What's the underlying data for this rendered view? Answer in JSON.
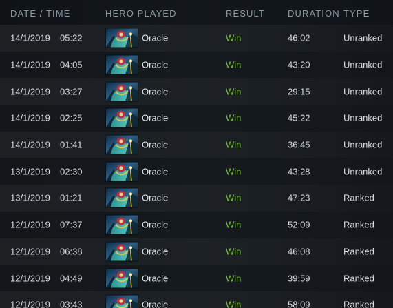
{
  "header": {
    "date_time": "DATE / TIME",
    "hero_played": "HERO PLAYED",
    "result": "RESULT",
    "duration": "DURATION",
    "type": "TYPE"
  },
  "colors": {
    "win": "#7cc13d",
    "text": "#d7dde2",
    "header": "#8e9aa3",
    "background": "#101417"
  },
  "rows": [
    {
      "date": "14/1/2019",
      "time": "05:22",
      "hero": "Oracle",
      "result": "Win",
      "duration": "46:02",
      "type": "Unranked"
    },
    {
      "date": "14/1/2019",
      "time": "04:05",
      "hero": "Oracle",
      "result": "Win",
      "duration": "43:20",
      "type": "Unranked"
    },
    {
      "date": "14/1/2019",
      "time": "03:27",
      "hero": "Oracle",
      "result": "Win",
      "duration": "29:15",
      "type": "Unranked"
    },
    {
      "date": "14/1/2019",
      "time": "02:25",
      "hero": "Oracle",
      "result": "Win",
      "duration": "45:22",
      "type": "Unranked"
    },
    {
      "date": "14/1/2019",
      "time": "01:41",
      "hero": "Oracle",
      "result": "Win",
      "duration": "36:45",
      "type": "Unranked"
    },
    {
      "date": "13/1/2019",
      "time": "02:30",
      "hero": "Oracle",
      "result": "Win",
      "duration": "43:28",
      "type": "Unranked"
    },
    {
      "date": "13/1/2019",
      "time": "01:21",
      "hero": "Oracle",
      "result": "Win",
      "duration": "47:23",
      "type": "Ranked"
    },
    {
      "date": "12/1/2019",
      "time": "07:37",
      "hero": "Oracle",
      "result": "Win",
      "duration": "52:09",
      "type": "Ranked"
    },
    {
      "date": "12/1/2019",
      "time": "06:38",
      "hero": "Oracle",
      "result": "Win",
      "duration": "46:08",
      "type": "Ranked"
    },
    {
      "date": "12/1/2019",
      "time": "04:49",
      "hero": "Oracle",
      "result": "Win",
      "duration": "39:59",
      "type": "Ranked"
    },
    {
      "date": "12/1/2019",
      "time": "03:43",
      "hero": "Oracle",
      "result": "Win",
      "duration": "58:09",
      "type": "Ranked"
    }
  ]
}
